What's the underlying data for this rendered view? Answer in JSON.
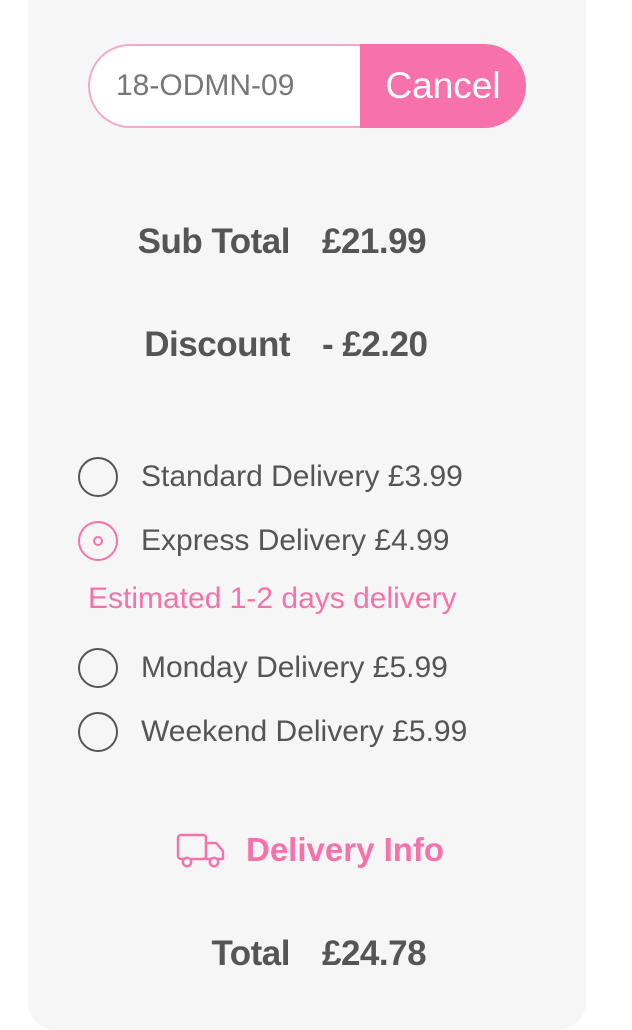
{
  "promo": {
    "code": "18-ODMN-09",
    "cancel_label": "Cancel"
  },
  "summary": {
    "subtotal_label": "Sub Total",
    "subtotal_value": "£21.99",
    "discount_label": "Discount",
    "discount_value": "- £2.20",
    "total_label": "Total",
    "total_value": "£24.78"
  },
  "delivery": {
    "options": [
      {
        "label": "Standard Delivery £3.99",
        "selected": false
      },
      {
        "label": "Express Delivery £4.99",
        "selected": true
      },
      {
        "label": "Monday Delivery £5.99",
        "selected": false
      },
      {
        "label": "Weekend Delivery £5.99",
        "selected": false
      }
    ],
    "estimate": "Estimated 1-2 days delivery",
    "info_label": "Delivery Info",
    "info_icon": "truck-icon"
  },
  "colors": {
    "accent": "#f772aa",
    "text": "#555555",
    "card_background": "#f6f6f6"
  }
}
